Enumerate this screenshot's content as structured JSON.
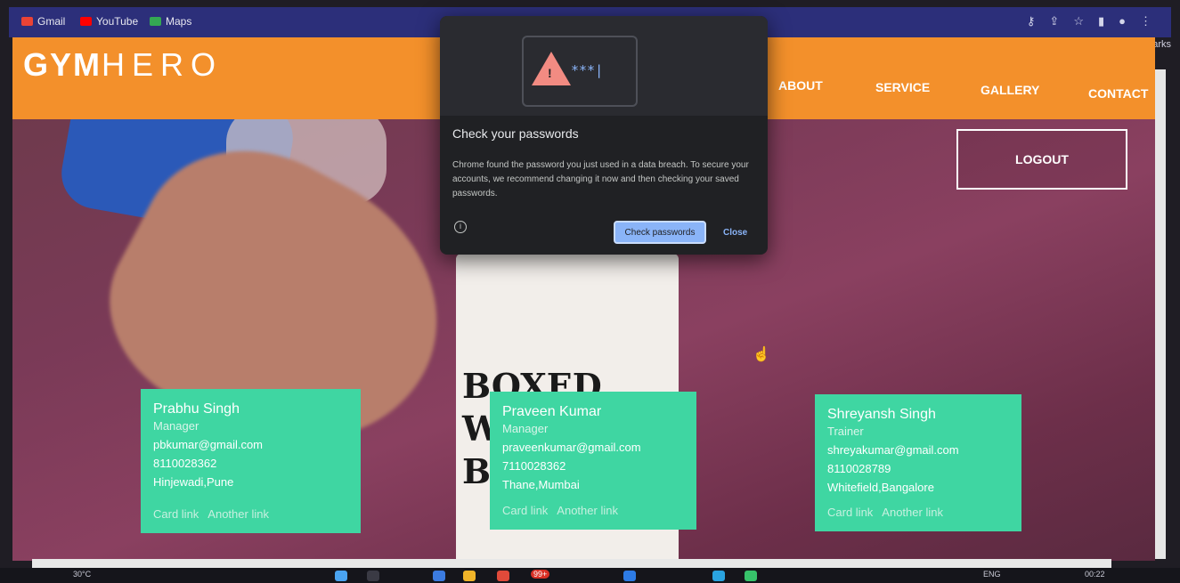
{
  "bookmarks": {
    "items": [
      {
        "label": "Gmail",
        "color": "#ea4335"
      },
      {
        "label": "YouTube",
        "color": "#ff0000"
      },
      {
        "label": "Maps",
        "color": "#34a853"
      }
    ],
    "other": "Other bookmarks"
  },
  "site": {
    "logo_bold": "GYM",
    "logo_thin": "HERO",
    "nav": [
      "ABOUT",
      "SERVICE",
      "GALLERY",
      "CONTACT"
    ],
    "logout": "LOGOUT"
  },
  "popup": {
    "title": "Check your passwords",
    "body": "Chrome found the password you just used in a data breach. To secure your accounts, we recommend changing it now and then checking your saved passwords.",
    "stars": "***|",
    "primary": "Check passwords",
    "secondary": "Close"
  },
  "cards": [
    {
      "name": "Prabhu Singh",
      "role": "Manager",
      "email": "pbkumar@gmail.com",
      "phone": "8110028362",
      "address": "Hinjewadi,Pune",
      "link1": "Card link",
      "link2": "Another link"
    },
    {
      "name": "Praveen Kumar",
      "role": "Manager",
      "email": "praveenkumar@gmail.com",
      "phone": "7110028362",
      "address": "Thane,Mumbai",
      "link1": "Card link",
      "link2": "Another link"
    },
    {
      "name": "Shreyansh Singh",
      "role": "Trainer",
      "email": "shreyakumar@gmail.com",
      "phone": "8110028789",
      "address": "Whitefield,Bangalore",
      "link1": "Card link",
      "link2": "Another link"
    }
  ],
  "hero_text": "BOXED WATER IS BETTER",
  "taskbar": {
    "weather": "30°C",
    "badge": "99+",
    "lang": "ENG",
    "time": "00:22"
  },
  "colors": {
    "header": "#f3902b",
    "card": "#3fd6a2",
    "popup_bg": "#202124",
    "accent": "#8ab4f8"
  }
}
